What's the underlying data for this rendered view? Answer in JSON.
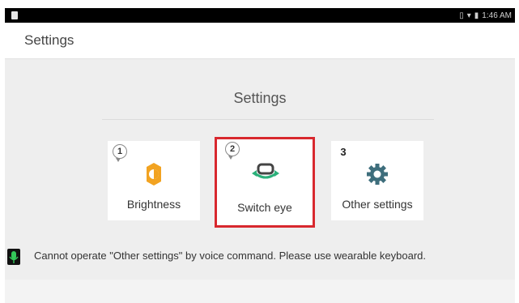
{
  "status_bar": {
    "time": "1:46 AM"
  },
  "app_bar": {
    "title": "Settings"
  },
  "section": {
    "title": "Settings"
  },
  "cards": [
    {
      "number": "1",
      "label": "Brightness",
      "icon": "brightness-icon"
    },
    {
      "number": "2",
      "label": "Switch eye",
      "icon": "switch-eye-icon",
      "selected": true
    },
    {
      "number": "3",
      "label": "Other settings",
      "icon": "gear-icon"
    }
  ],
  "voice_message": "Cannot operate \"Other settings\" by voice command. Please use wearable keyboard.",
  "colors": {
    "selection_border": "#d8282e",
    "brightness_icon": "#f2a321",
    "switch_eye_icon": "#2bb07a",
    "gear_icon": "#3e6e7c",
    "mic_icon": "#34c759"
  }
}
